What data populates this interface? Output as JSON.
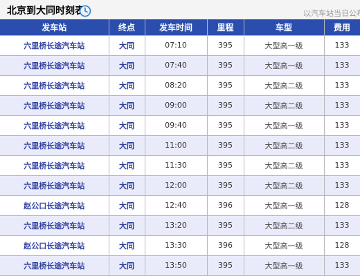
{
  "header": {
    "title": "北京到大同时刻表",
    "note": "以汽车站当日公布时",
    "icon": "clock-icon"
  },
  "columns": [
    "发车站",
    "终点",
    "发车时间",
    "里程",
    "车型",
    "费用"
  ],
  "rows": [
    {
      "station": "六里桥长途汽车站",
      "dest": "大同",
      "time": "07:10",
      "distance": "395",
      "type": "大型高一级",
      "fare": "133"
    },
    {
      "station": "六里桥长途汽车站",
      "dest": "大同",
      "time": "07:40",
      "distance": "395",
      "type": "大型高一级",
      "fare": "133"
    },
    {
      "station": "六里桥长途汽车站",
      "dest": "大同",
      "time": "08:20",
      "distance": "395",
      "type": "大型高二级",
      "fare": "133"
    },
    {
      "station": "六里桥长途汽车站",
      "dest": "大同",
      "time": "09:00",
      "distance": "395",
      "type": "大型高二级",
      "fare": "133"
    },
    {
      "station": "六里桥长途汽车站",
      "dest": "大同",
      "time": "09:40",
      "distance": "395",
      "type": "大型高一级",
      "fare": "133"
    },
    {
      "station": "六里桥长途汽车站",
      "dest": "大同",
      "time": "11:00",
      "distance": "395",
      "type": "大型高二级",
      "fare": "133"
    },
    {
      "station": "六里桥长途汽车站",
      "dest": "大同",
      "time": "11:30",
      "distance": "395",
      "type": "大型高二级",
      "fare": "133"
    },
    {
      "station": "六里桥长途汽车站",
      "dest": "大同",
      "time": "12:00",
      "distance": "395",
      "type": "大型高二级",
      "fare": "133"
    },
    {
      "station": "赵公口长途汽车站",
      "dest": "大同",
      "time": "12:40",
      "distance": "396",
      "type": "大型高一级",
      "fare": "128"
    },
    {
      "station": "六里桥长途汽车站",
      "dest": "大同",
      "time": "13:20",
      "distance": "395",
      "type": "大型高二级",
      "fare": "133"
    },
    {
      "station": "赵公口长途汽车站",
      "dest": "大同",
      "time": "13:30",
      "distance": "396",
      "type": "大型高一级",
      "fare": "128"
    },
    {
      "station": "六里桥长途汽车站",
      "dest": "大同",
      "time": "13:50",
      "distance": "395",
      "type": "大型高一级",
      "fare": "133"
    }
  ],
  "colors": {
    "header_bg": "#2b4eae",
    "alt_row_bg": "#e9ebfb",
    "link_text": "#2f3fa0"
  }
}
